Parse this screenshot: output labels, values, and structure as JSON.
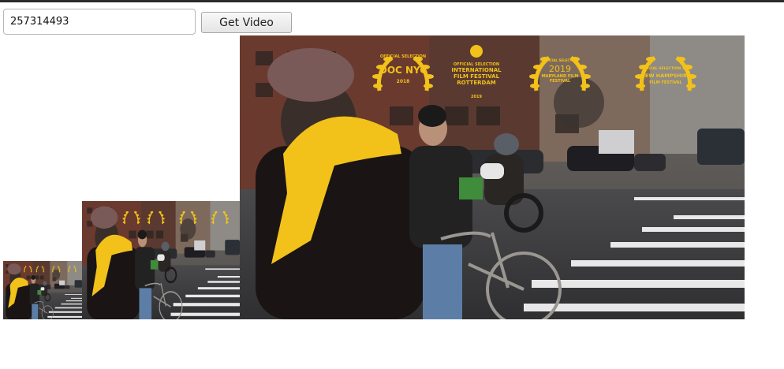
{
  "search": {
    "value": "257314493"
  },
  "button": {
    "label": "Get Video"
  },
  "video": {
    "laurels": [
      {
        "top": "OFFICIAL SELECTION",
        "main": "DOC NYC",
        "bottom": "2018"
      },
      {
        "top": "OFFICIAL SELECTION",
        "main": "INTERNATIONAL FILM FESTIVAL ROTTERDAM",
        "bottom": "2019"
      },
      {
        "top": "OFFICIAL SELECTION",
        "main": "2019",
        "bottom": "MARYLAND FILM FESTIVAL"
      },
      {
        "top": "OFFICIAL SELECTION 2019",
        "main": "NEW HAMPSHIRE",
        "bottom": "FILM FESTIVAL"
      }
    ]
  }
}
